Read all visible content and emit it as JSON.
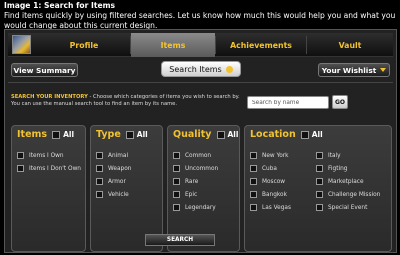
{
  "caption": {
    "title": "Image 1: Search for Items",
    "line1": "Find items quickly by using filtered searches. Let us know how much this would help you and what you would",
    "link": "change about this current design."
  },
  "tabs": [
    "Profile",
    "Items",
    "Achievements",
    "Vault"
  ],
  "toolbar": {
    "view_summary": "View Summary",
    "search_items": "Search Items",
    "wishlist": "Your Wishlist"
  },
  "intro": {
    "highlight": "SEARCH YOUR INVENTORY",
    "text": " - Choose which categories of items you wish to search by. You can use the manual search tool to find an item by its name."
  },
  "search": {
    "placeholder": "Search by name",
    "go_label": "GO"
  },
  "panels": {
    "items": {
      "title": "Items",
      "all": "All",
      "options": [
        "Items I Own",
        "Items I Don't Own"
      ]
    },
    "type": {
      "title": "Type",
      "all": "All",
      "options": [
        "Animal",
        "Weapon",
        "Armor",
        "Vehicle"
      ]
    },
    "quality": {
      "title": "Quality",
      "all": "All",
      "options": [
        "Common",
        "Uncommon",
        "Rare",
        "Epic",
        "Legendary"
      ]
    },
    "location": {
      "title": "Location",
      "all": "All",
      "options_left": [
        "New York",
        "Cuba",
        "Moscow",
        "Bangkok",
        "Las Vegas"
      ],
      "options_right": [
        "Italy",
        "Figting",
        "Marketplace",
        "Challenge Mission",
        "Special Event"
      ]
    }
  },
  "search_button": "SEARCH",
  "colors": {
    "accent": "#f1c232",
    "panel_bg": "#333333",
    "frame_bg": "#222222"
  }
}
